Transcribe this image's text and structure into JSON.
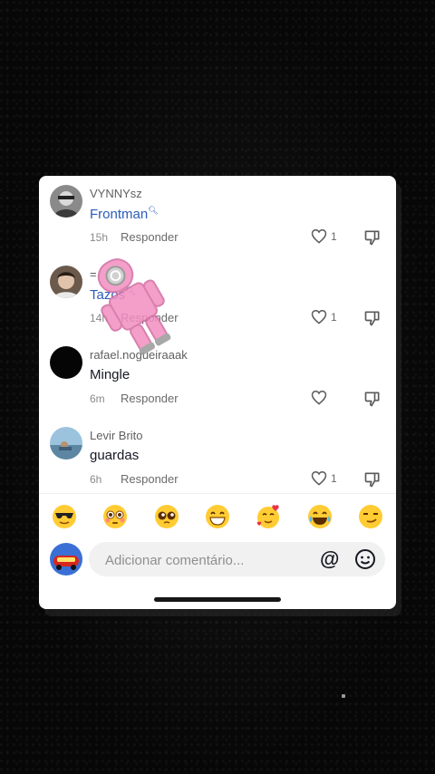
{
  "comments": [
    {
      "username": "VYNNYsz",
      "text": "Frontman",
      "time": "15h",
      "reply": "Responder",
      "likes": "1"
    },
    {
      "username": "=",
      "text": "Tazos",
      "time": "14h",
      "reply": "Responder",
      "likes": "1"
    },
    {
      "username": "rafael.nogueiraaak",
      "text": "Mingle",
      "time": "6m",
      "reply": "Responder",
      "likes": ""
    },
    {
      "username": "Levir Brito",
      "text": "guardas",
      "time": "6h",
      "reply": "Responder",
      "likes": "1"
    }
  ],
  "emoji_bar": [
    "cool-sunglasses",
    "flushed",
    "pleading",
    "grinning",
    "smiling-hearts",
    "tears-of-joy",
    "smirk"
  ],
  "input": {
    "placeholder": "Adicionar comentário...",
    "at_label": "@"
  },
  "colors": {
    "accent_link": "#2b5db9",
    "card": "#ffffff",
    "background": "#070707",
    "sticker": "#f28fc0"
  }
}
